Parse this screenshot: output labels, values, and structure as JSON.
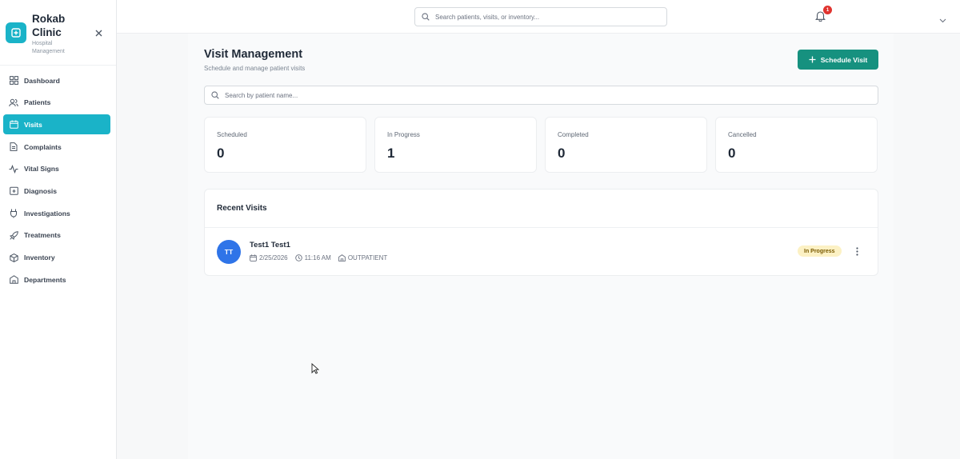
{
  "brand": {
    "name": "Rokab Clinic",
    "subtitle": "Hospital Management"
  },
  "sidebar": {
    "items": [
      {
        "label": "Dashboard",
        "icon": "dashboard-icon",
        "active": false
      },
      {
        "label": "Patients",
        "icon": "users-icon",
        "active": false
      },
      {
        "label": "Visits",
        "icon": "calendar-icon",
        "active": true
      },
      {
        "label": "Complaints",
        "icon": "document-icon",
        "active": false
      },
      {
        "label": "Vital Signs",
        "icon": "activity-icon",
        "active": false
      },
      {
        "label": "Diagnosis",
        "icon": "clipboard-icon",
        "active": false
      },
      {
        "label": "Investigations",
        "icon": "test-tube-icon",
        "active": false
      },
      {
        "label": "Treatments",
        "icon": "rocket-icon",
        "active": false
      },
      {
        "label": "Inventory",
        "icon": "box-icon",
        "active": false
      },
      {
        "label": "Departments",
        "icon": "building-icon",
        "active": false
      }
    ]
  },
  "topbar": {
    "search_placeholder": "Search patients, visits, or inventory...",
    "notification_count": "1"
  },
  "page": {
    "title": "Visit Management",
    "subtitle": "Schedule and manage patient visits",
    "schedule_button": "Schedule Visit",
    "search_placeholder": "Search by patient name..."
  },
  "stats": [
    {
      "label": "Scheduled",
      "value": "0"
    },
    {
      "label": "In Progress",
      "value": "1"
    },
    {
      "label": "Completed",
      "value": "0"
    },
    {
      "label": "Cancelled",
      "value": "0"
    }
  ],
  "recent": {
    "title": "Recent Visits",
    "visits": [
      {
        "initials": "TT",
        "name": "Test1 Test1",
        "date": "2/25/2026",
        "time": "11:16 AM",
        "type": "OUTPATIENT",
        "status": "In Progress"
      }
    ]
  },
  "colors": {
    "accent": "#1ab3c8",
    "primary_button": "#16917f",
    "avatar": "#2f74e8",
    "badge": "#e0342f",
    "status_in_progress_bg": "#fcf1c4"
  }
}
